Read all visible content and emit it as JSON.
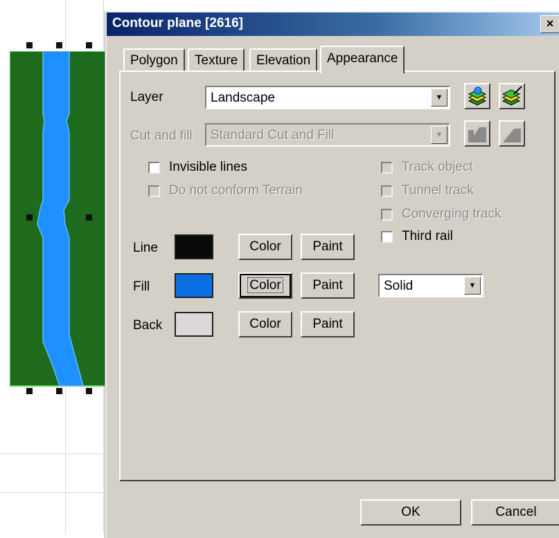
{
  "dialog": {
    "title": "Contour plane [2616]",
    "close_glyph": "×"
  },
  "tabs": [
    {
      "label": "Polygon",
      "active": false
    },
    {
      "label": "Texture",
      "active": false
    },
    {
      "label": "Elevation",
      "active": false
    },
    {
      "label": "Appearance",
      "active": true
    }
  ],
  "layer": {
    "label": "Layer",
    "value": "Landscape",
    "icons": [
      "layers-add-icon",
      "layers-edit-icon"
    ]
  },
  "cut_fill": {
    "label": "Cut and fill",
    "value": "Standard Cut and Fill",
    "icons": [
      "terrain-cut-icon",
      "terrain-slope-icon"
    ]
  },
  "checks_left": [
    {
      "label": "Invisible lines",
      "checked": false,
      "enabled": true
    },
    {
      "label": "Do not conform Terrain",
      "checked": false,
      "enabled": false
    }
  ],
  "checks_right": [
    {
      "label": "Track object",
      "checked": false,
      "enabled": false
    },
    {
      "label": "Tunnel track",
      "checked": false,
      "enabled": false
    },
    {
      "label": "Converging track",
      "checked": false,
      "enabled": false
    },
    {
      "label": "Third rail",
      "checked": false,
      "enabled": true
    }
  ],
  "colors": [
    {
      "label": "Line",
      "swatch": "#0a0a0a",
      "color_btn": "Color",
      "paint_btn": "Paint"
    },
    {
      "label": "Fill",
      "swatch": "#0a6fe0",
      "color_btn": "Color",
      "paint_btn": "Paint"
    },
    {
      "label": "Back",
      "swatch": "#dcd8d8",
      "color_btn": "Color",
      "paint_btn": "Paint"
    }
  ],
  "fill_style": {
    "value": "Solid"
  },
  "footer": {
    "ok": "OK",
    "cancel": "Cancel"
  },
  "canvas_colors": {
    "terrain": "#1e6b1e",
    "water": "#1e90ff"
  }
}
